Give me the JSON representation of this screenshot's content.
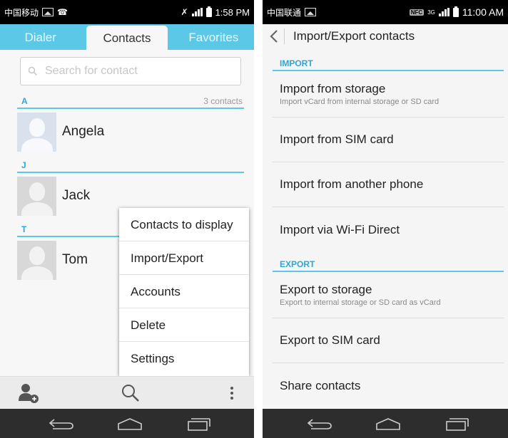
{
  "left_screen": {
    "status": {
      "carrier": "中国移动",
      "time": "1:58 PM"
    },
    "tabs": [
      "Dialer",
      "Contacts",
      "Favorites"
    ],
    "search_placeholder": "Search for contact",
    "sections": [
      {
        "letter": "A",
        "count": "3 contacts",
        "contacts": [
          "Angela"
        ]
      },
      {
        "letter": "J",
        "contacts": [
          "Jack"
        ]
      },
      {
        "letter": "T",
        "contacts": [
          "Tom"
        ]
      }
    ],
    "menu": [
      "Contacts to display",
      "Import/Export",
      "Accounts",
      "Delete",
      "Settings"
    ],
    "icons": [
      "add-contact-icon",
      "search-icon",
      "overflow-menu-icon"
    ]
  },
  "right_screen": {
    "status": {
      "carrier": "中国联通",
      "nfc": "NFC",
      "network": "3G",
      "time": "11:00 AM"
    },
    "title": "Import/Export contacts",
    "import_header": "IMPORT",
    "import_items": [
      {
        "title": "Import from storage",
        "subtitle": "Import vCard from internal storage or SD card"
      },
      {
        "title": "Import from SIM card"
      },
      {
        "title": "Import from another phone"
      },
      {
        "title": "Import via Wi-Fi Direct"
      }
    ],
    "export_header": "EXPORT",
    "export_items": [
      {
        "title": "Export to storage",
        "subtitle": "Export to internal storage or SD card as vCard"
      },
      {
        "title": "Export to SIM card"
      },
      {
        "title": "Share contacts"
      }
    ]
  },
  "colors": {
    "accent": "#5bc8e8",
    "section_text": "#2aa9d6",
    "nav_bar": "#2d2d2d"
  }
}
